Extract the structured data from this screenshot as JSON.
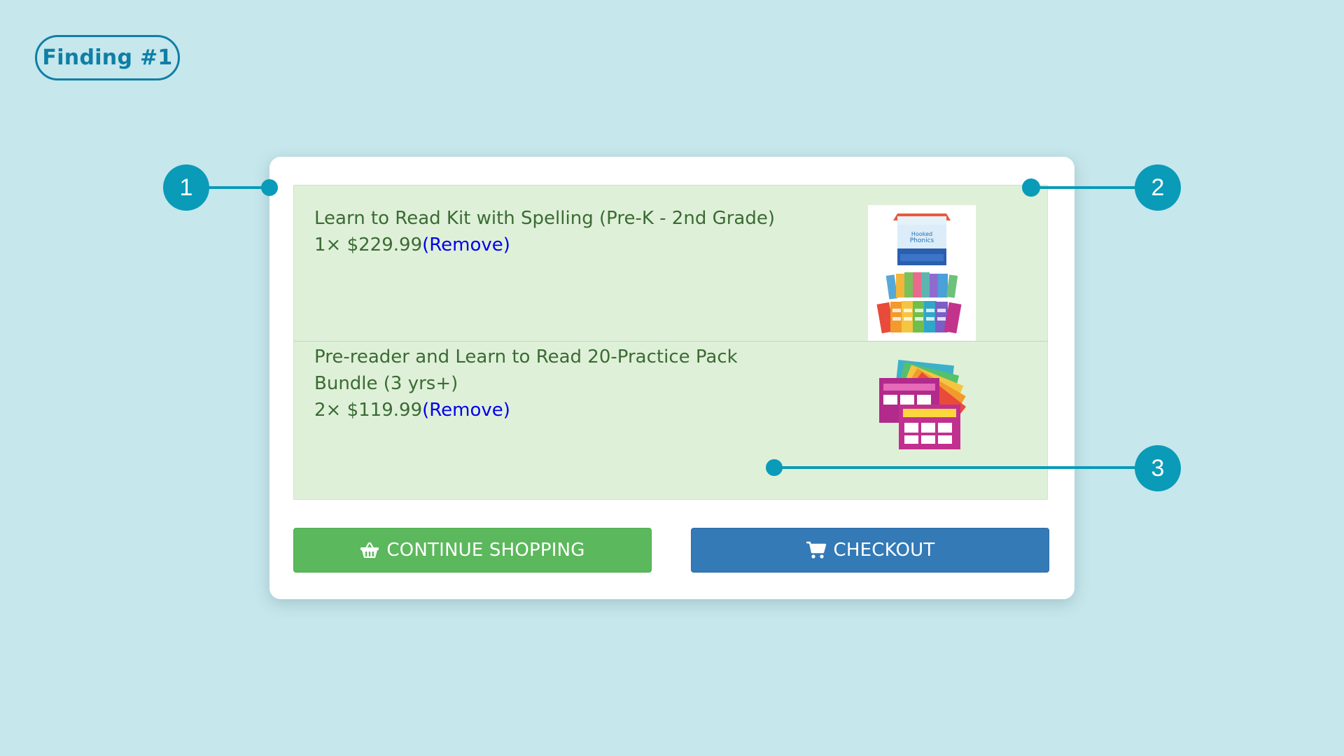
{
  "finding_label": "Finding #1",
  "cart": {
    "items": [
      {
        "title": "Learn to Read Kit with Spelling (Pre-K - 2nd Grade)",
        "title_line2": "",
        "price_line": "1× $229.99",
        "remove_label": "(Remove)",
        "thumbnail_icon": "product-kit-image"
      },
      {
        "title": "Pre-reader and Learn to Read 20-Practice Pack",
        "title_line2": "Bundle (3 yrs+)",
        "price_line": "2× $119.99",
        "remove_label": "(Remove)",
        "thumbnail_icon": "practice-pack-image"
      }
    ]
  },
  "buttons": {
    "continue_label": "CONTINUE SHOPPING",
    "continue_icon": "basket-icon",
    "checkout_label": "CHECKOUT",
    "checkout_icon": "cart-icon"
  },
  "annotations": {
    "markers": [
      "1",
      "2",
      "3"
    ],
    "color": "#0a9bb8"
  },
  "colors": {
    "background": "#c6e7ec",
    "cart_bg": "#dff0d8",
    "item_text": "#3a6b34",
    "link": "#0000ee",
    "continue_btn": "#5cb85c",
    "checkout_btn": "#337ab7"
  }
}
